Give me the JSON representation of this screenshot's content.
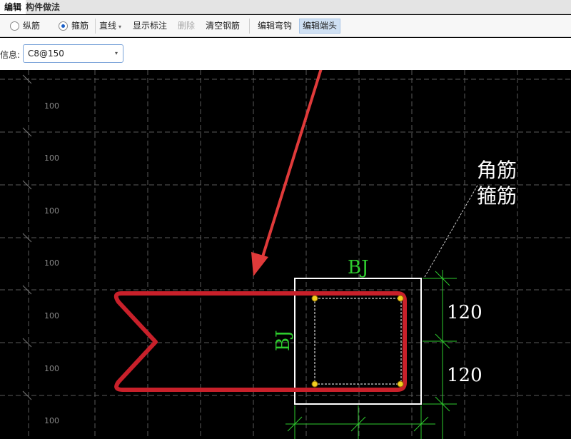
{
  "tabs": [
    {
      "label": "编辑",
      "active": true
    },
    {
      "label": "构件做法",
      "active": false
    }
  ],
  "toolbar": {
    "longitudinal_label": "纵筋",
    "stirrup_label": "箍筋",
    "selected_mode": "stirrup",
    "line_type_label": "直线",
    "show_dims_label": "显示标注",
    "delete_label": "删除",
    "clear_label": "清空钢筋",
    "edit_bend_label": "编辑弯钩",
    "edit_end_label": "编辑端头"
  },
  "info": {
    "label": "信息:",
    "rebar_value": "C8@150"
  },
  "canvas": {
    "row_labels": [
      "100",
      "100",
      "100",
      "100",
      "100",
      "100",
      "100"
    ],
    "dim_side_bottom": "BJ",
    "dim_side_left": "BJ",
    "dim_right_top": "120",
    "dim_right_bottom": "120",
    "annotation_line1": "角筋",
    "annotation_line2": "箍筋"
  },
  "colors": {
    "rebar": "#c8202a",
    "arrow": "#e03a3a",
    "dimension": "#2ecc2e",
    "section": "#ffffff",
    "corner_dot": "#f2d020"
  }
}
